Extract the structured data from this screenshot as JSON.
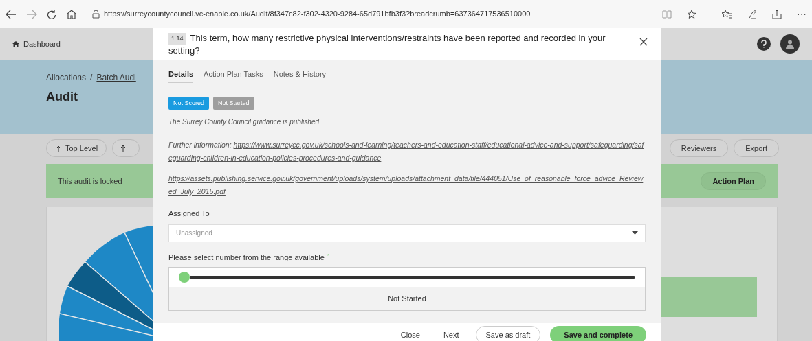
{
  "browser": {
    "url": "https://surreycountycouncil.vc-enable.co.uk/Audit/8f347c82-f302-4320-9284-65d791bfb3f3?breadcrumb=637364717536510000",
    "more": "···"
  },
  "app_header": {
    "home_link": "Dashboard"
  },
  "breadcrumb": {
    "items": [
      "Allocations",
      "Batch Audi"
    ],
    "separator": "/"
  },
  "page_title": "Audit",
  "toolbar_left": [
    "Top Level"
  ],
  "toolbar_right": [
    "Reviewers",
    "Export"
  ],
  "lock_banner": {
    "text": "This audit is locked",
    "button": "Action Plan"
  },
  "modal": {
    "number": "1.14",
    "question": "This term, how many restrictive physical interventions/restraints have been reported and recorded in your setting?",
    "tabs": [
      {
        "label": "Details",
        "selected": true
      },
      {
        "label": "Action Plan Tasks",
        "selected": false
      },
      {
        "label": "Notes & History",
        "selected": false
      }
    ],
    "badges": [
      {
        "label": "Not Scored",
        "color": "#1a9be0"
      },
      {
        "label": "Not Started",
        "color": "#9e9e9e"
      }
    ],
    "guidance": "The Surrey County Council guidance is published",
    "further_label": "Further information:",
    "further_link": "https://www.surreycc.gov.uk/schools-and-learning/teachers-and-education-staff/educational-advice-and-support/safeguarding/safeguarding-children-in-education-policies-procedures-and-guidance",
    "attachment_link": "https://assets.publishing.service.gov.uk/government/uploads/system/uploads/attachment_data/file/444051/Use_of_reasonable_force_advice_Reviewed_July_2015.pdf",
    "assigned_label": "Assigned To",
    "assigned_placeholder": "Unassigned",
    "range_label": "Please select number from the range available",
    "required_mark": "*",
    "slider": {
      "level": 0
    },
    "range_status": "Not Started",
    "footer_buttons": [
      {
        "label": "Close",
        "kind": "text"
      },
      {
        "label": "Next",
        "kind": "text"
      },
      {
        "label": "Save as draft",
        "kind": "outline"
      },
      {
        "label": "Save and complete",
        "kind": "primary"
      }
    ]
  }
}
